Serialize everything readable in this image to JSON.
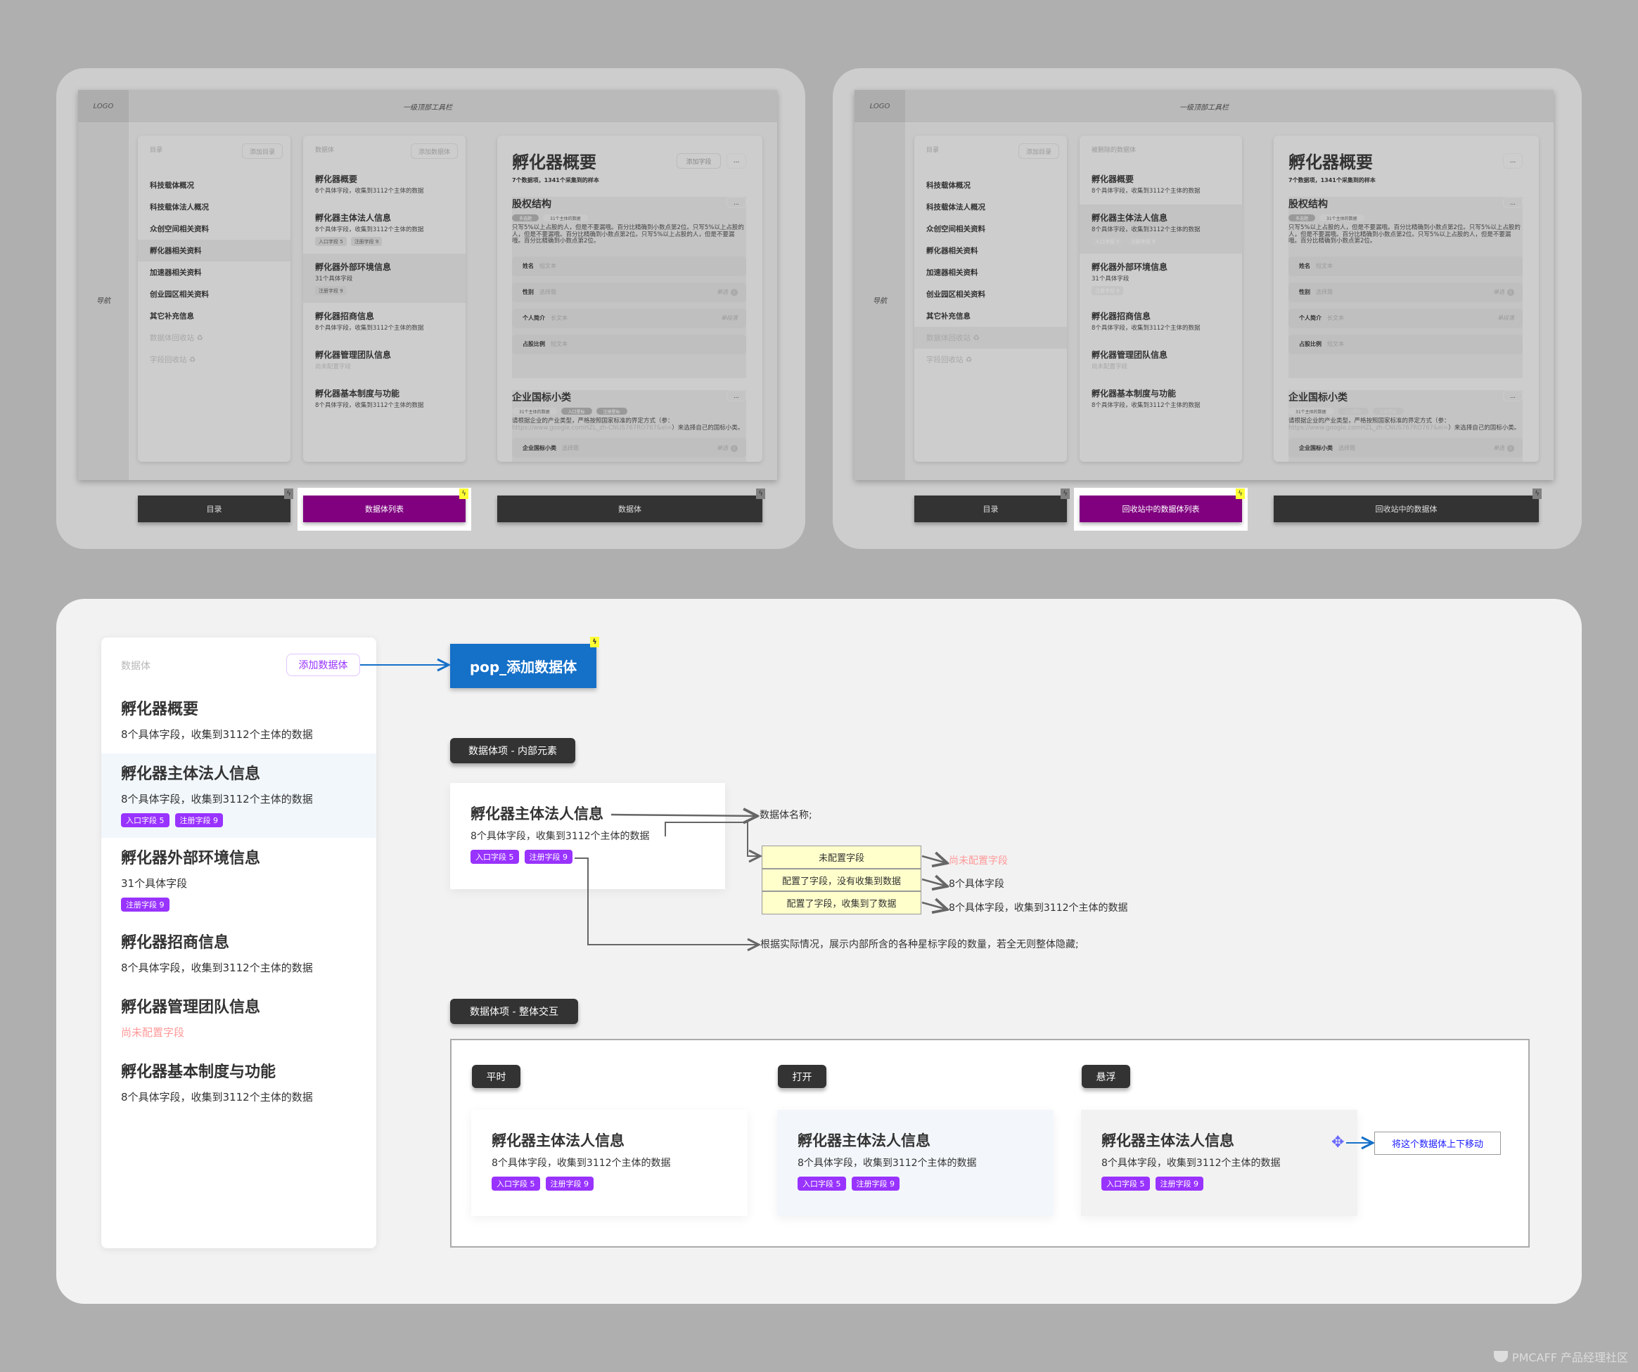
{
  "mockups": [
    {
      "logo": "LOGO",
      "toolbar_title": "一级顶部工具栏",
      "nav_label": "导航",
      "catalog": {
        "label": "目录",
        "add_button": "添加目录",
        "items": [
          "科技载体概况",
          "科技载体法人概况",
          "众创空间相关资料",
          "孵化器相关资料",
          "加速器相关资料",
          "创业园区相关资料",
          "其它补充信息"
        ],
        "recycle_items": [
          "数据体回收站 ♻",
          "字段回收站 ♻"
        ],
        "selected": "孵化器相关资料"
      },
      "list": {
        "label": "数据体",
        "add_button": "添加数据体",
        "tags_disabled": false,
        "selected_index": 2,
        "items": [
          {
            "title": "孵化器概要",
            "sub": "8个具体字段，收集到3112个主体的数据",
            "tags": []
          },
          {
            "title": "孵化器主体法人信息",
            "sub": "8个具体字段，收集到3112个主体的数据",
            "tags": [
              "入口字段 5",
              "注册字段 9"
            ]
          },
          {
            "title": "孵化器外部环境信息",
            "sub": "31个具体字段",
            "tags": [
              "注册字段 9"
            ]
          },
          {
            "title": "孵化器招商信息",
            "sub": "8个具体字段，收集到3112个主体的数据",
            "tags": []
          },
          {
            "title": "孵化器管理团队信息",
            "sub": "尚未配置字段",
            "sub_muted": true,
            "tags": []
          },
          {
            "title": "孵化器基本制度与功能",
            "sub": "8个具体字段，收集到3112个主体的数据",
            "tags": []
          }
        ]
      },
      "detail": {
        "title": "孵化器概要",
        "add_button": "添加字段",
        "more": "...",
        "summary": "7个数据项，1341个采集到的样本",
        "sections": [
          {
            "title": "股权结构",
            "tags": [
              {
                "text": "多选题",
                "style": "dark"
              },
              {
                "text": "31个主体的数据",
                "style": "light"
              }
            ],
            "desc": "只写5%以上占股的人，但是不要漏哦。百分比精确到小数点第2位。只写5%以上占股的人，但是不要漏哦。百分比精确到小数点第2位。只写5%以上占股的人，但是不要漏哦。百分比精确到小数点第2位。",
            "link": "",
            "desc_end": "",
            "fields": [
              {
                "name": "姓名",
                "type": "短文本",
                "note": ""
              },
              {
                "name": "性别",
                "type": "选择题",
                "note": "单选",
                "info": true
              },
              {
                "name": "个人简介",
                "type": "长文本",
                "note": "单段落"
              },
              {
                "name": "占股比例",
                "type": "短文本",
                "note": ""
              }
            ]
          },
          {
            "title": "企业国标小类",
            "tags": [
              {
                "text": "31个主体的数据",
                "style": "light"
              },
              {
                "text": "入口星标",
                "style": "dark"
              },
              {
                "text": "注册星标",
                "style": "dark"
              }
            ],
            "desc": "请根据企业的产业类型，严格按照国家标准的界定方式（参：",
            "link": "https://www.google.comHZL_zh-CNUS767RO767&ei=",
            "desc_end": "）来选择自己的国标小类。",
            "fields": [
              {
                "name": "企业国标小类",
                "type": "选择题",
                "note": "单选",
                "info": true
              }
            ]
          }
        ]
      },
      "buttons": [
        {
          "label": "目录",
          "active": false
        },
        {
          "label": "数据体列表",
          "active": true
        },
        {
          "label": "数据体",
          "active": false
        }
      ]
    },
    {
      "logo": "LOGO",
      "toolbar_title": "一级顶部工具栏",
      "nav_label": "导航",
      "catalog": {
        "label": "目录",
        "add_button": "添加目录",
        "items": [
          "科技载体概况",
          "科技载体法人概况",
          "众创空间相关资料",
          "孵化器相关资料",
          "加速器相关资料",
          "创业园区相关资料",
          "其它补充信息"
        ],
        "recycle_items": [
          "数据体回收站 ♻",
          "字段回收站 ♻"
        ],
        "selected": "数据体回收站 ♻"
      },
      "list": {
        "label": "被删除的数据体",
        "add_button": null,
        "tags_disabled": true,
        "selected_index": 1,
        "items": [
          {
            "title": "孵化器概要",
            "sub": "8个具体字段，收集到3112个主体的数据",
            "tags": []
          },
          {
            "title": "孵化器主体法人信息",
            "sub": "8个具体字段，收集到3112个主体的数据",
            "tags": [
              "入口字段 5",
              "注册字段 9"
            ]
          },
          {
            "title": "孵化器外部环境信息",
            "sub": "31个具体字段",
            "tags": [
              "注册字段 9"
            ]
          },
          {
            "title": "孵化器招商信息",
            "sub": "8个具体字段，收集到3112个主体的数据",
            "tags": []
          },
          {
            "title": "孵化器管理团队信息",
            "sub": "尚未配置字段",
            "sub_muted": true,
            "tags": []
          },
          {
            "title": "孵化器基本制度与功能",
            "sub": "8个具体字段，收集到3112个主体的数据",
            "tags": []
          }
        ]
      },
      "detail": {
        "title": "孵化器概要",
        "add_button": null,
        "more": "...",
        "summary": "7个数据项，1341个采集到的样本",
        "sections": [
          {
            "title": "股权结构",
            "tags": [
              {
                "text": "多选题",
                "style": "dark"
              },
              {
                "text": "31个主体的数据",
                "style": "light"
              }
            ],
            "desc": "只写5%以上占股的人，但是不要漏哦。百分比精确到小数点第2位。只写5%以上占股的人，但是不要漏哦。百分比精确到小数点第2位。只写5%以上占股的人，但是不要漏哦。百分比精确到小数点第2位。",
            "link": "",
            "desc_end": "",
            "fields": [
              {
                "name": "姓名",
                "type": "短文本",
                "note": ""
              },
              {
                "name": "性别",
                "type": "选择题",
                "note": "单选",
                "info": true
              },
              {
                "name": "个人简介",
                "type": "长文本",
                "note": "单段落"
              },
              {
                "name": "占股比例",
                "type": "短文本",
                "note": ""
              }
            ]
          },
          {
            "title": "企业国标小类",
            "tags": [
              {
                "text": "31个主体的数据",
                "style": "light"
              },
              {
                "text": "入口星标",
                "style": "off"
              },
              {
                "text": "注册星标",
                "style": "off"
              }
            ],
            "desc": "请根据企业的产业类型，严格按照国家标准的界定方式（参：",
            "link": "https://www.google.comHZL_zh-CNUS767RO767&ei=",
            "desc_end": "）来选择自己的国标小类。",
            "fields": [
              {
                "name": "企业国标小类",
                "type": "选择题",
                "note": "单选",
                "info": true
              }
            ]
          }
        ]
      },
      "buttons": [
        {
          "label": "目录",
          "active": false
        },
        {
          "label": "回收站中的数据体列表",
          "active": true
        },
        {
          "label": "回收站中的数据体",
          "active": false
        }
      ]
    }
  ],
  "detail_list": {
    "label": "数据体",
    "add_button": "添加数据体",
    "selected_index": 1,
    "items": [
      {
        "title": "孵化器概要",
        "sub": "8个具体字段，收集到3112个主体的数据",
        "tags": []
      },
      {
        "title": "孵化器主体法人信息",
        "sub": "8个具体字段，收集到3112个主体的数据",
        "tags": [
          "入口字段 5",
          "注册字段 9"
        ]
      },
      {
        "title": "孵化器外部环境信息",
        "sub": "31个具体字段",
        "tags": [
          "注册字段 9"
        ]
      },
      {
        "title": "孵化器招商信息",
        "sub": "8个具体字段，收集到3112个主体的数据",
        "tags": []
      },
      {
        "title": "孵化器管理团队信息",
        "sub": "尚未配置字段",
        "sub_muted": true,
        "tags": []
      },
      {
        "title": "孵化器基本制度与功能",
        "sub": "8个具体字段，收集到3112个主体的数据",
        "tags": []
      }
    ]
  },
  "pop": {
    "label": "pop_添加数据体"
  },
  "inner": {
    "label": "数据体项 - 内部元素",
    "card": {
      "title": "孵化器主体法人信息",
      "sub": "8个具体字段，收集到3112个主体的数据",
      "tags": [
        "入口字段 5",
        "注册字段 9"
      ]
    },
    "name_note": "数据体名称;",
    "states": [
      {
        "state": "未配置字段",
        "result": "尚未配置字段"
      },
      {
        "state": "配置了字段，没有收集到数据",
        "result": "8个具体字段"
      },
      {
        "state": "配置了字段，收集到了数据",
        "result": "8个具体字段，收集到3112个主体的数据"
      }
    ],
    "tags_note": "根据实际情况，展示内部所含的各种星标字段的数量，若全无则整体隐藏;"
  },
  "interaction": {
    "label": "数据体项 - 整体交互",
    "states": [
      {
        "label": "平时",
        "bg": "#ffffff"
      },
      {
        "label": "打开",
        "bg": "#f3f7fb"
      },
      {
        "label": "悬浮",
        "bg": "#f2f2f2"
      }
    ],
    "card": {
      "title": "孵化器主体法人信息",
      "sub": "8个具体字段，收集到3112个主体的数据",
      "tags": [
        "入口字段 5",
        "注册字段 9"
      ]
    },
    "move_hint": "将这个数据体上下移动"
  },
  "colors": {
    "purple_tag": "#9933ff",
    "active_button": "#800080",
    "pop_blue": "#1570c8",
    "pink_note": "#ff9999",
    "hint_blue": "#1a1aff",
    "state_yellow": "#ffffcc"
  },
  "watermark": "PMCAFF 产品经理社区"
}
